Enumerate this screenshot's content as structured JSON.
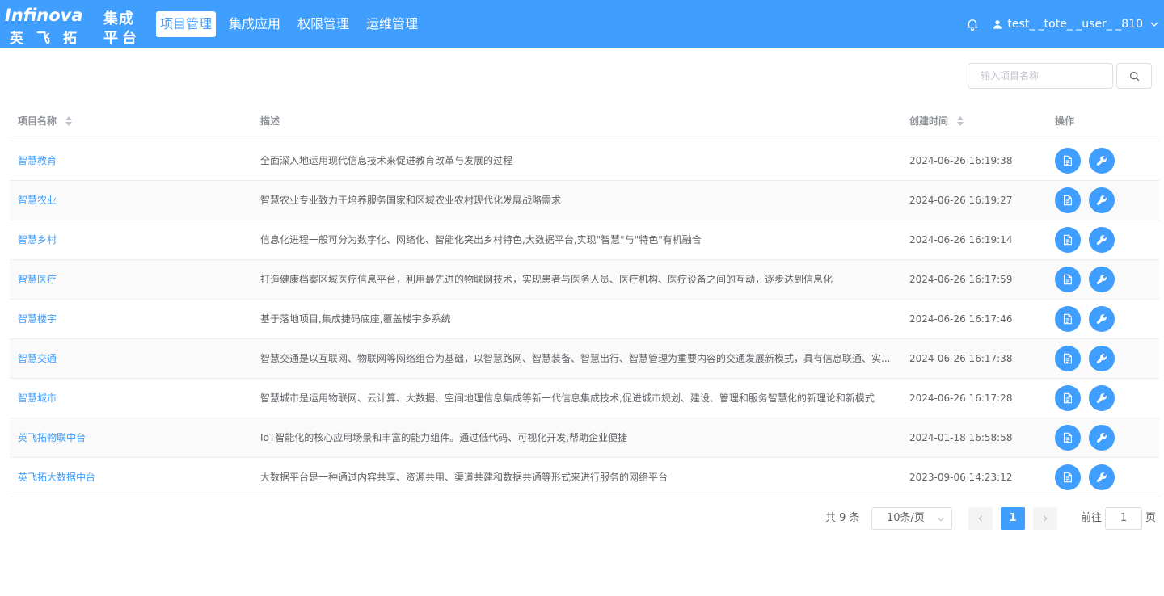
{
  "brand": {
    "name_en": "Infinova",
    "name_cn": "英飞拓",
    "subtitle_line1": "集成",
    "subtitle_line2": "平台"
  },
  "nav": [
    {
      "label": "项目管理",
      "active": true
    },
    {
      "label": "集成应用",
      "active": false
    },
    {
      "label": "权限管理",
      "active": false
    },
    {
      "label": "运维管理",
      "active": false
    }
  ],
  "user": {
    "name": "test_ _tote_ _user_ _810"
  },
  "search": {
    "placeholder": "输入项目名称",
    "value": ""
  },
  "table": {
    "columns": {
      "name": "项目名称",
      "desc": "描述",
      "time": "创建时间",
      "ops": "操作"
    },
    "rows": [
      {
        "name": "智慧教育",
        "desc": "全面深入地运用现代信息技术来促进教育改革与发展的过程",
        "time": "2024-06-26 16:19:38"
      },
      {
        "name": "智慧农业",
        "desc": "智慧农业专业致力于培养服务国家和区域农业农村现代化发展战略需求",
        "time": "2024-06-26 16:19:27"
      },
      {
        "name": "智慧乡村",
        "desc": "信息化进程一般可分为数字化、网络化、智能化突出乡村特色,大数据平台,实现\"智慧\"与\"特色\"有机融合",
        "time": "2024-06-26 16:19:14"
      },
      {
        "name": "智慧医疗",
        "desc": "打造健康档案区域医疗信息平台，利用最先进的物联网技术，实现患者与医务人员、医疗机构、医疗设备之间的互动，逐步达到信息化",
        "time": "2024-06-26 16:17:59"
      },
      {
        "name": "智慧楼宇",
        "desc": "基于落地项目,集成捷码底座,覆盖楼宇多系统",
        "time": "2024-06-26 16:17:46"
      },
      {
        "name": "智慧交通",
        "desc": "智慧交通是以互联网、物联网等网络组合为基础，以智慧路网、智慧装备、智慧出行、智慧管理为重要内容的交通发展新模式，具有信息联通、实...",
        "time": "2024-06-26 16:17:38"
      },
      {
        "name": "智慧城市",
        "desc": "智慧城市是运用物联网、云计算、大数据、空间地理信息集成等新一代信息集成技术,促进城市规划、建设、管理和服务智慧化的新理论和新模式",
        "time": "2024-06-26 16:17:28"
      },
      {
        "name": "英飞拓物联中台",
        "desc": "IoT智能化的核心应用场景和丰富的能力组件。通过低代码、可视化开发,帮助企业便捷",
        "time": "2024-01-18 16:58:58"
      },
      {
        "name": "英飞拓大数据中台",
        "desc": "大数据平台是一种通过内容共享、资源共用、渠道共建和数据共通等形式来进行服务的网络平台",
        "time": "2023-09-06 14:23:12"
      }
    ]
  },
  "pagination": {
    "total_text": "共 9 条",
    "page_size": "10条/页",
    "current_page": "1",
    "goto_label": "前往",
    "goto_value": "1",
    "goto_suffix": "页"
  },
  "colors": {
    "primary": "#409eff",
    "header_bg": "#409eff"
  }
}
